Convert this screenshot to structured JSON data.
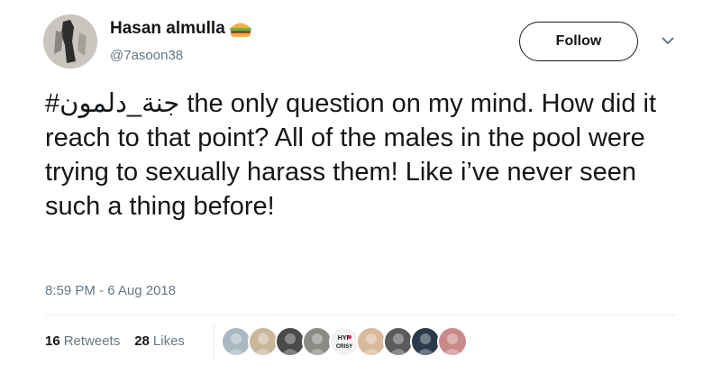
{
  "user": {
    "display_name": "Hasan almulla",
    "handle": "@7asoon38",
    "name_emoji": "burger-emoji-icon"
  },
  "actions": {
    "follow_label": "Follow"
  },
  "tweet": {
    "hashtag": "#جنة_دلمون",
    "text_after_hashtag": " the only question on my mind. How did it reach to that point? All of the males in the pool were trying to sexually harass them! Like i’ve never seen such a thing before!",
    "timestamp": "8:59 PM - 6 Aug 2018"
  },
  "stats": {
    "retweets_count": "16",
    "retweets_label": "Retweets",
    "likes_count": "28",
    "likes_label": "Likes"
  },
  "likers": [
    {
      "name": "liker-avatar-1",
      "color": "#aab8c2"
    },
    {
      "name": "liker-avatar-2",
      "color": "#c9b79c"
    },
    {
      "name": "liker-avatar-3",
      "color": "#4a4a4a"
    },
    {
      "name": "liker-avatar-4",
      "color": "#8c8a87"
    },
    {
      "name": "liker-avatar-5",
      "color": "#f2f2f2",
      "text_top": "HYP",
      "text_bottom": "CRISY"
    },
    {
      "name": "liker-avatar-6",
      "color": "#d9b99b"
    },
    {
      "name": "liker-avatar-7",
      "color": "#5b5b5b"
    },
    {
      "name": "liker-avatar-8",
      "color": "#2a3a4a"
    },
    {
      "name": "liker-avatar-9",
      "color": "#c98a8a"
    }
  ],
  "colors": {
    "text": "#14171a",
    "secondary": "#657786",
    "divider": "#e6ecf0"
  }
}
